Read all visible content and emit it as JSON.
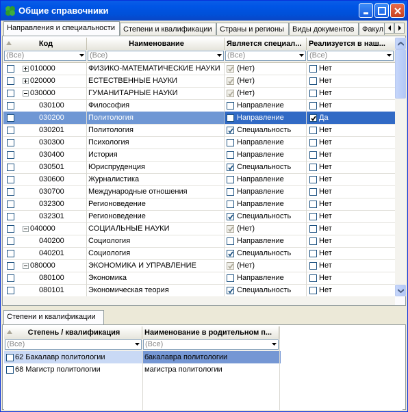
{
  "window": {
    "title": "Общие справочники",
    "colors": {
      "title_bar": "#0055e5",
      "selection": "#316ac5",
      "selection_cell": "#6f97d4"
    }
  },
  "tabs": [
    {
      "label": "Направления и специальности",
      "active": true
    },
    {
      "label": "Степени и квалификации",
      "active": false
    },
    {
      "label": "Страны и регионы",
      "active": false
    },
    {
      "label": "Виды документов",
      "active": false
    },
    {
      "label": "Факул",
      "active": false
    }
  ],
  "main_grid": {
    "columns": [
      "Код",
      "Наименование",
      "Является специал...",
      "Реализуется в наш..."
    ],
    "filters": [
      "(Все)",
      "(Все)",
      "(Все)",
      "(Все)"
    ],
    "rows": [
      {
        "code": "010000",
        "name": "ФИЗИКО-МАТЕМАТИЧЕСКИЕ НАУКИ",
        "type": "(Нет)",
        "realized": "Нет",
        "group": "plus",
        "type_checked": true,
        "type_disabled": true,
        "realized_checked": false
      },
      {
        "code": "020000",
        "name": "ЕСТЕСТВЕННЫЕ НАУКИ",
        "type": "(Нет)",
        "realized": "Нет",
        "group": "plus",
        "type_checked": true,
        "type_disabled": true,
        "realized_checked": false
      },
      {
        "code": "030000",
        "name": "ГУМАНИТАРНЫЕ НАУКИ",
        "type": "(Нет)",
        "realized": "Нет",
        "group": "minus",
        "type_checked": true,
        "type_disabled": true,
        "realized_checked": false
      },
      {
        "code": "030100",
        "name": "Философия",
        "type": "Направление",
        "realized": "Нет",
        "group": "",
        "type_checked": false,
        "type_disabled": false,
        "realized_checked": false
      },
      {
        "code": "030200",
        "name": "Политология",
        "type": "Направление",
        "realized": "Да",
        "group": "",
        "type_checked": false,
        "type_disabled": false,
        "realized_checked": true,
        "selected": true
      },
      {
        "code": "030201",
        "name": "Политология",
        "type": "Специальность",
        "realized": "Нет",
        "group": "",
        "type_checked": true,
        "type_disabled": false,
        "realized_checked": false
      },
      {
        "code": "030300",
        "name": "Психология",
        "type": "Направление",
        "realized": "Нет",
        "group": "",
        "type_checked": false,
        "type_disabled": false,
        "realized_checked": false
      },
      {
        "code": "030400",
        "name": "История",
        "type": "Направление",
        "realized": "Нет",
        "group": "",
        "type_checked": false,
        "type_disabled": false,
        "realized_checked": false
      },
      {
        "code": "030501",
        "name": "Юриспруденция",
        "type": "Специальность",
        "realized": "Нет",
        "group": "",
        "type_checked": true,
        "type_disabled": false,
        "realized_checked": false
      },
      {
        "code": "030600",
        "name": "Журналистика",
        "type": "Направление",
        "realized": "Нет",
        "group": "",
        "type_checked": false,
        "type_disabled": false,
        "realized_checked": false
      },
      {
        "code": "030700",
        "name": "Международные отношения",
        "type": "Направление",
        "realized": "Нет",
        "group": "",
        "type_checked": false,
        "type_disabled": false,
        "realized_checked": false
      },
      {
        "code": "032300",
        "name": "Регионоведение",
        "type": "Направление",
        "realized": "Нет",
        "group": "",
        "type_checked": false,
        "type_disabled": false,
        "realized_checked": false
      },
      {
        "code": "032301",
        "name": "Регионоведение",
        "type": "Специальность",
        "realized": "Нет",
        "group": "",
        "type_checked": true,
        "type_disabled": false,
        "realized_checked": false
      },
      {
        "code": "040000",
        "name": "СОЦИАЛЬНЫЕ НАУКИ",
        "type": "(Нет)",
        "realized": "Нет",
        "group": "minus",
        "type_checked": true,
        "type_disabled": true,
        "realized_checked": false
      },
      {
        "code": "040200",
        "name": "Социология",
        "type": "Направление",
        "realized": "Нет",
        "group": "",
        "type_checked": false,
        "type_disabled": false,
        "realized_checked": false
      },
      {
        "code": "040201",
        "name": "Социология",
        "type": "Специальность",
        "realized": "Нет",
        "group": "",
        "type_checked": true,
        "type_disabled": false,
        "realized_checked": false
      },
      {
        "code": "080000",
        "name": "ЭКОНОМИКА И УПРАВЛЕНИЕ",
        "type": "(Нет)",
        "realized": "Нет",
        "group": "minus",
        "type_checked": true,
        "type_disabled": true,
        "realized_checked": false
      },
      {
        "code": "080100",
        "name": "Экономика",
        "type": "Направление",
        "realized": "Нет",
        "group": "",
        "type_checked": false,
        "type_disabled": false,
        "realized_checked": false
      },
      {
        "code": "080101",
        "name": "Экономическая теория",
        "type": "Специальность",
        "realized": "Нет",
        "group": "",
        "type_checked": true,
        "type_disabled": false,
        "realized_checked": false
      }
    ]
  },
  "bottom_tabs": [
    {
      "label": "Степени и квалификации",
      "active": true
    }
  ],
  "detail_grid": {
    "columns": [
      "Степень / квалификация",
      "Наименование в родительном п..."
    ],
    "filters": [
      "(Все)",
      "(Все)"
    ],
    "rows": [
      {
        "degree": "62 Бакалавр политологии",
        "genitive": "бакалавра политологии",
        "selected": true
      },
      {
        "degree": "68 Магистр политологии",
        "genitive": "магистра политологии",
        "selected": false
      }
    ]
  },
  "icons": [
    "app-leaf-icon",
    "minimize-icon",
    "maximize-icon",
    "close-icon",
    "sort-up-icon",
    "dropdown-arrow-icon",
    "checkmark-icon",
    "expand-plus-icon",
    "collapse-minus-icon",
    "scroll-up-icon",
    "scroll-down-icon",
    "tab-scroll-left-icon",
    "tab-scroll-right-icon"
  ]
}
